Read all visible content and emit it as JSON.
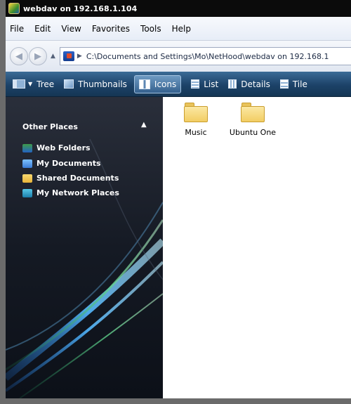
{
  "window": {
    "title": "webdav on 192.168.1.104"
  },
  "menu": [
    "File",
    "Edit",
    "View",
    "Favorites",
    "Tools",
    "Help"
  ],
  "address": {
    "path": "C:\\Documents and Settings\\Mo\\NetHood\\webdav on 192.168.1"
  },
  "toolbar": {
    "tree": "Tree",
    "thumbnails": "Thumbnails",
    "icons": "Icons",
    "list": "List",
    "details": "Details",
    "tile": "Tile"
  },
  "sidebar": {
    "header": "Other Places",
    "items": [
      "Web Folders",
      "My Documents",
      "Shared Documents",
      "My Network Places"
    ]
  },
  "files": [
    {
      "name": "Music",
      "type": "folder"
    },
    {
      "name": "Ubuntu One",
      "type": "folder"
    }
  ]
}
